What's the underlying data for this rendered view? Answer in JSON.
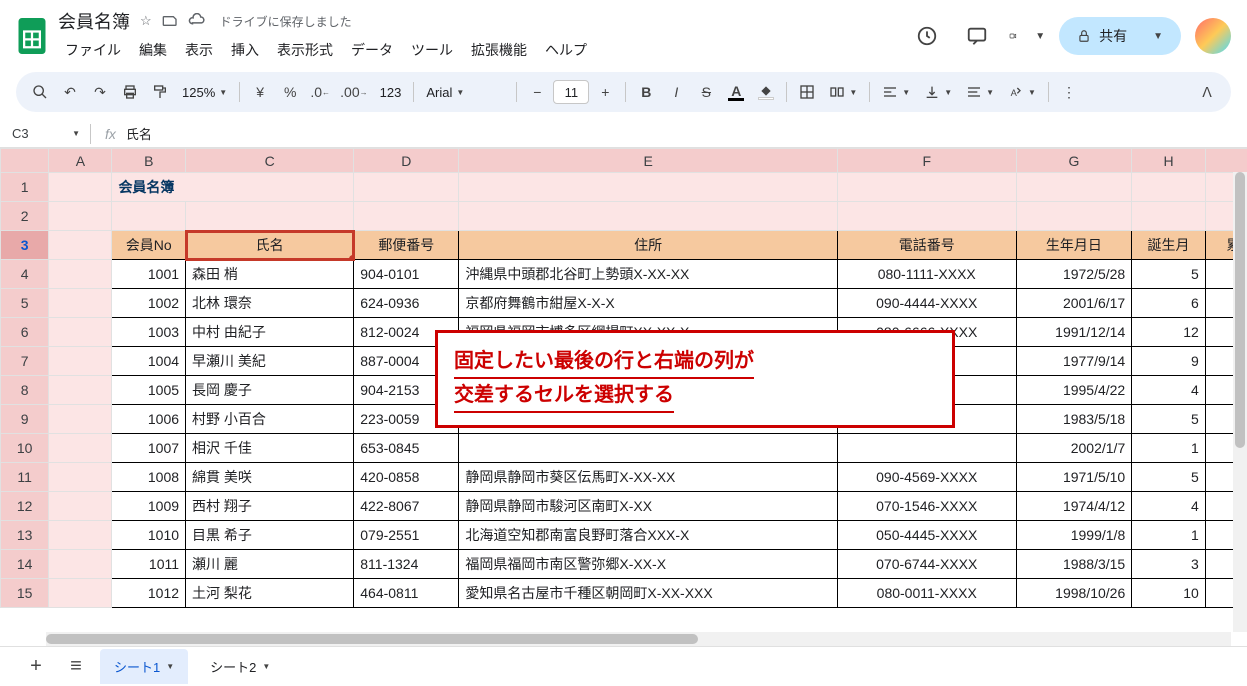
{
  "doc": {
    "title": "会員名簿",
    "save_status": "ドライブに保存しました"
  },
  "menu": {
    "file": "ファイル",
    "edit": "編集",
    "view": "表示",
    "insert": "挿入",
    "format": "表示形式",
    "data": "データ",
    "tools": "ツール",
    "extensions": "拡張機能",
    "help": "ヘルプ"
  },
  "share": {
    "label": "共有"
  },
  "toolbar": {
    "zoom": "125%",
    "font": "Arial",
    "font_size": "11",
    "format_123": "123"
  },
  "name_box": {
    "ref": "C3"
  },
  "formula": {
    "value": "氏名"
  },
  "columns": [
    "A",
    "B",
    "C",
    "D",
    "E",
    "F",
    "G",
    "H"
  ],
  "row_headers": [
    "1",
    "2",
    "3",
    "4",
    "5",
    "6",
    "7",
    "8",
    "9",
    "10",
    "11",
    "12",
    "13",
    "14",
    "15"
  ],
  "title_cell": "会員名簿",
  "headers": {
    "b": "会員No",
    "c": "氏名",
    "d": "郵便番号",
    "e": "住所",
    "f": "電話番号",
    "g": "生年月日",
    "h": "誕生月",
    "i": "累計購"
  },
  "chart_data": {
    "type": "table",
    "columns": [
      "会員No",
      "氏名",
      "郵便番号",
      "住所",
      "電話番号",
      "生年月日",
      "誕生月"
    ],
    "rows": [
      {
        "b": "1001",
        "c": "森田 梢",
        "d": "904-0101",
        "e": "沖縄県中頭郡北谷町上勢頭X-XX-XX",
        "f": "080-1111-XXXX",
        "g": "1972/5/28",
        "h": "5"
      },
      {
        "b": "1002",
        "c": "北林 環奈",
        "d": "624-0936",
        "e": "京都府舞鶴市紺屋X-X-X",
        "f": "090-4444-XXXX",
        "g": "2001/6/17",
        "h": "6"
      },
      {
        "b": "1003",
        "c": "中村 由紀子",
        "d": "812-0024",
        "e": "福岡県福岡市博多区網場町XX-XX-X",
        "f": "080-6666-XXXX",
        "g": "1991/12/14",
        "h": "12"
      },
      {
        "b": "1004",
        "c": "早瀬川 美紀",
        "d": "887-0004",
        "e": "",
        "f": "",
        "g": "1977/9/14",
        "h": "9"
      },
      {
        "b": "1005",
        "c": "長岡 慶子",
        "d": "904-2153",
        "e": "",
        "f": "",
        "g": "1995/4/22",
        "h": "4"
      },
      {
        "b": "1006",
        "c": "村野 小百合",
        "d": "223-0059",
        "e": "",
        "f": "",
        "g": "1983/5/18",
        "h": "5"
      },
      {
        "b": "1007",
        "c": "相沢 千佳",
        "d": "653-0845",
        "e": "",
        "f": "",
        "g": "2002/1/7",
        "h": "1"
      },
      {
        "b": "1008",
        "c": "綿貫 美咲",
        "d": "420-0858",
        "e": "静岡県静岡市葵区伝馬町X-XX-XX",
        "f": "090-4569-XXXX",
        "g": "1971/5/10",
        "h": "5"
      },
      {
        "b": "1009",
        "c": "西村 翔子",
        "d": "422-8067",
        "e": "静岡県静岡市駿河区南町X-XX",
        "f": "070-1546-XXXX",
        "g": "1974/4/12",
        "h": "4"
      },
      {
        "b": "1010",
        "c": "目黒 希子",
        "d": "079-2551",
        "e": "北海道空知郡南富良野町落合XXX-X",
        "f": "050-4445-XXXX",
        "g": "1999/1/8",
        "h": "1"
      },
      {
        "b": "1011",
        "c": "瀬川 麗",
        "d": "811-1324",
        "e": "福岡県福岡市南区警弥郷X-XX-X",
        "f": "070-6744-XXXX",
        "g": "1988/3/15",
        "h": "3"
      },
      {
        "b": "1012",
        "c": "土河 梨花",
        "d": "464-0811",
        "e": "愛知県名古屋市千種区朝岡町X-XX-XXX",
        "f": "080-0011-XXXX",
        "g": "1998/10/26",
        "h": "10"
      }
    ]
  },
  "callout": {
    "line1": "固定したい最後の行と右端の列が",
    "line2": "交差するセルを選択する"
  },
  "tabs": {
    "sheet1": "シート1",
    "sheet2": "シート2"
  }
}
